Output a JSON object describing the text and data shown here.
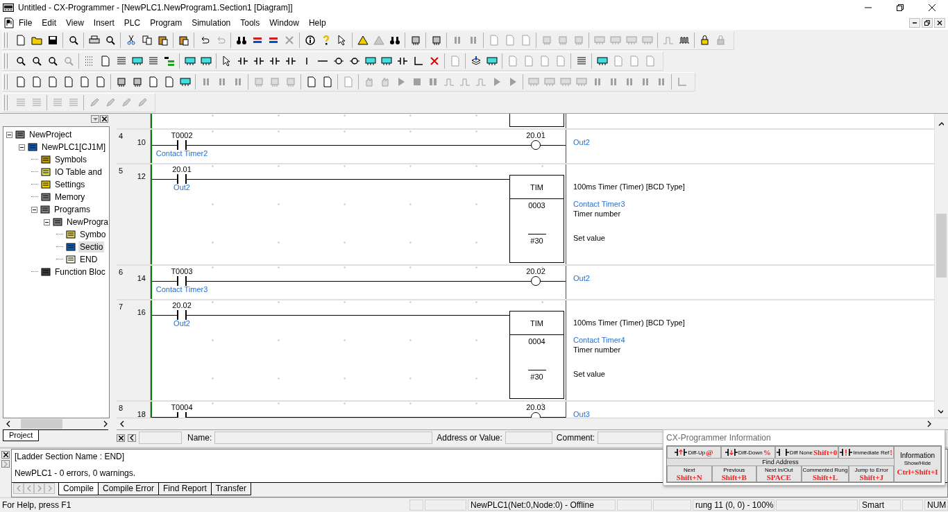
{
  "window": {
    "title": "Untitled - CX-Programmer - [NewPLC1.NewProgram1.Section1 [Diagram]]"
  },
  "menu": [
    "File",
    "Edit",
    "View",
    "Insert",
    "PLC",
    "Program",
    "Simulation",
    "Tools",
    "Window",
    "Help"
  ],
  "toolbars": [
    [
      [
        {
          "disabled": false
        },
        {
          "disabled": false
        },
        {
          "disabled": false
        }
      ],
      [
        {
          "disabled": false
        }
      ],
      [
        {
          "disabled": false
        },
        {
          "disabled": false
        }
      ],
      [
        {
          "disabled": false
        },
        {
          "disabled": false
        },
        {
          "disabled": false
        }
      ],
      [
        {
          "disabled": false
        }
      ],
      [
        {
          "disabled": false
        },
        {
          "disabled": true
        }
      ],
      [
        {
          "disabled": false
        },
        {
          "disabled": false
        },
        {
          "disabled": false
        },
        {
          "disabled": true
        }
      ],
      [
        {
          "disabled": false
        },
        {
          "disabled": false
        },
        {
          "disabled": false
        }
      ],
      [
        {
          "disabled": false
        },
        {
          "disabled": true
        },
        {
          "disabled": false
        }
      ],
      [
        {
          "disabled": false
        }
      ],
      [
        {
          "disabled": false
        }
      ],
      [
        {
          "disabled": true
        },
        {
          "disabled": true
        }
      ],
      [
        {
          "disabled": true
        },
        {
          "disabled": true
        },
        {
          "disabled": true
        }
      ],
      [
        {
          "disabled": true
        },
        {
          "disabled": true
        },
        {
          "disabled": true
        }
      ],
      [
        {
          "disabled": true
        },
        {
          "disabled": true
        },
        {
          "disabled": true
        },
        {
          "disabled": true
        }
      ],
      [
        {
          "disabled": true
        },
        {
          "disabled": false
        }
      ],
      [
        {
          "disabled": false
        },
        {
          "disabled": true
        }
      ]
    ],
    [
      [
        {
          "disabled": false
        },
        {
          "disabled": false
        },
        {
          "disabled": false
        },
        {
          "disabled": true
        }
      ],
      [
        {
          "disabled": false
        },
        {
          "disabled": false
        },
        {
          "disabled": false
        },
        {
          "disabled": false
        },
        {
          "disabled": false
        },
        {
          "disabled": false
        }
      ],
      [
        {
          "disabled": false
        },
        {
          "disabled": false
        }
      ],
      [
        {
          "disabled": false
        },
        {
          "disabled": false
        },
        {
          "disabled": false
        },
        {
          "disabled": false
        },
        {
          "disabled": false
        },
        {
          "disabled": false
        },
        {
          "disabled": false
        },
        {
          "disabled": false
        },
        {
          "disabled": false
        },
        {
          "disabled": false
        },
        {
          "disabled": false
        },
        {
          "disabled": false
        },
        {
          "disabled": false
        },
        {
          "disabled": false
        }
      ],
      [
        {
          "disabled": true
        }
      ],
      [
        {
          "disabled": false
        },
        {
          "disabled": false
        }
      ],
      [
        {
          "disabled": true
        },
        {
          "disabled": true
        },
        {
          "disabled": true
        },
        {
          "disabled": true
        }
      ],
      [
        {
          "disabled": false
        }
      ],
      [
        {
          "disabled": false
        },
        {
          "disabled": true
        },
        {
          "disabled": true
        },
        {
          "disabled": true
        }
      ]
    ],
    [
      [
        {
          "disabled": false
        },
        {
          "disabled": false
        },
        {
          "disabled": false
        },
        {
          "disabled": false
        },
        {
          "disabled": false
        },
        {
          "disabled": false
        }
      ],
      [
        {
          "disabled": false
        },
        {
          "disabled": false
        },
        {
          "disabled": false
        },
        {
          "disabled": false
        },
        {
          "disabled": false
        }
      ],
      [
        {
          "disabled": true
        },
        {
          "disabled": true
        },
        {
          "disabled": true
        }
      ],
      [
        {
          "disabled": true
        },
        {
          "disabled": true
        },
        {
          "disabled": true
        }
      ],
      [
        {
          "disabled": false
        },
        {
          "disabled": false
        }
      ],
      [
        {
          "disabled": true
        }
      ],
      [
        {
          "disabled": true
        },
        {
          "disabled": true
        },
        {
          "disabled": true
        },
        {
          "disabled": true
        },
        {
          "disabled": true
        },
        {
          "disabled": true
        },
        {
          "disabled": true
        },
        {
          "disabled": true
        },
        {
          "disabled": true
        },
        {
          "disabled": true
        }
      ],
      [
        {
          "disabled": true
        },
        {
          "disabled": true
        },
        {
          "disabled": true
        },
        {
          "disabled": true
        },
        {
          "disabled": true
        },
        {
          "disabled": true
        },
        {
          "disabled": true
        },
        {
          "disabled": true
        },
        {
          "disabled": true
        }
      ],
      [
        {
          "disabled": true
        }
      ]
    ],
    [
      [
        {
          "disabled": true
        },
        {
          "disabled": true
        }
      ],
      [
        {
          "disabled": true
        },
        {
          "disabled": true
        }
      ],
      [
        {
          "disabled": true
        },
        {
          "disabled": true
        },
        {
          "disabled": true
        },
        {
          "disabled": true
        }
      ]
    ]
  ],
  "project_tree": {
    "tab": "Project",
    "items": [
      {
        "label": "NewProject",
        "expanded": true,
        "selected": false,
        "children": [
          {
            "label": "NewPLC1[CJ1M]",
            "expanded": true,
            "selected": false,
            "children": [
              {
                "label": "Symbols",
                "selected": false
              },
              {
                "label": "IO Table and",
                "selected": false
              },
              {
                "label": "Settings",
                "selected": false
              },
              {
                "label": "Memory",
                "selected": false
              },
              {
                "label": "Programs",
                "expanded": true,
                "selected": false,
                "children": [
                  {
                    "label": "NewProgra",
                    "expanded": true,
                    "selected": false,
                    "children": [
                      {
                        "label": "Symbo",
                        "selected": false
                      },
                      {
                        "label": "Sectio",
                        "selected": true
                      },
                      {
                        "label": "END",
                        "selected": false
                      }
                    ]
                  }
                ]
              },
              {
                "label": "Function Bloc",
                "selected": false
              }
            ]
          }
        ]
      }
    ]
  },
  "ladder": {
    "rungs": [
      {
        "kind": "continued"
      },
      {
        "kind": "coil",
        "number": "4",
        "line": "10",
        "contact": {
          "address": "T0002",
          "comment": "Contact Timer2"
        },
        "coil": {
          "address": "20.01",
          "comment": "Out2"
        }
      },
      {
        "kind": "timer",
        "number": "5",
        "line": "12",
        "contact": {
          "address": "20.01",
          "comment": "Out2"
        },
        "instruction": "TIM",
        "timer": "0003",
        "set_value": "#30",
        "description": "100ms Timer (Timer) [BCD Type]",
        "timer_comment": "Contact Timer3",
        "timer_label": "Timer number",
        "set_label": "Set value"
      },
      {
        "kind": "coil",
        "number": "6",
        "line": "14",
        "contact": {
          "address": "T0003",
          "comment": "Contact Timer3"
        },
        "coil": {
          "address": "20.02",
          "comment": "Out2"
        }
      },
      {
        "kind": "timer",
        "number": "7",
        "line": "16",
        "contact": {
          "address": "20.02",
          "comment": "Out2"
        },
        "instruction": "TIM",
        "timer": "0004",
        "set_value": "#30",
        "description": "100ms Timer (Timer) [BCD Type]",
        "timer_comment": "Contact Timer4",
        "timer_label": "Timer number",
        "set_label": "Set value"
      },
      {
        "kind": "coil",
        "number": "8",
        "line": "18",
        "contact": {
          "address": "T0004"
        },
        "coil": {
          "address": "20.03",
          "comment": "Out3"
        }
      }
    ]
  },
  "properties_bar": {
    "name_label": "Name:",
    "address_label": "Address or Value:",
    "comment_label": "Comment:"
  },
  "output": {
    "lines": [
      "[Ladder Section Name : END]",
      "NewPLC1 - 0 errors, 0 warnings."
    ],
    "tabs": [
      {
        "label": "Compile",
        "selected": true
      },
      {
        "label": "Compile Error",
        "selected": false
      },
      {
        "label": "Find Report",
        "selected": false
      },
      {
        "label": "Transfer",
        "selected": false
      }
    ]
  },
  "info_window": {
    "title": "CX-Programmer Information",
    "top_row": [
      {
        "label": "Diff-Up",
        "key": "@"
      },
      {
        "label": "Diff-Down",
        "key": "%"
      },
      {
        "label": "Diff None",
        "key": "Shift+0"
      },
      {
        "label": "Immediate Ref",
        "key": "!"
      }
    ],
    "find_label": "Find Address",
    "bottom_row": [
      {
        "label": "Next",
        "key": "Shift+N"
      },
      {
        "label": "Previous",
        "key": "Shift+B"
      },
      {
        "label": "Next In/Out",
        "key": "SPACE"
      },
      {
        "label": "Commented Rung",
        "key": "Shift+L"
      },
      {
        "label": "Jump to Error",
        "key": "Shift+J"
      }
    ],
    "info_button": {
      "label": "Information",
      "sublabel": "Show/Hide",
      "key": "Ctrl+Shift+I"
    }
  },
  "status_bar": {
    "help": "For Help, press F1",
    "panes": [
      "NewPLC1(Net:0,Node:0) - Offline",
      "rung 11 (0, 0)  - 100%",
      "Smart",
      "NUM"
    ]
  }
}
